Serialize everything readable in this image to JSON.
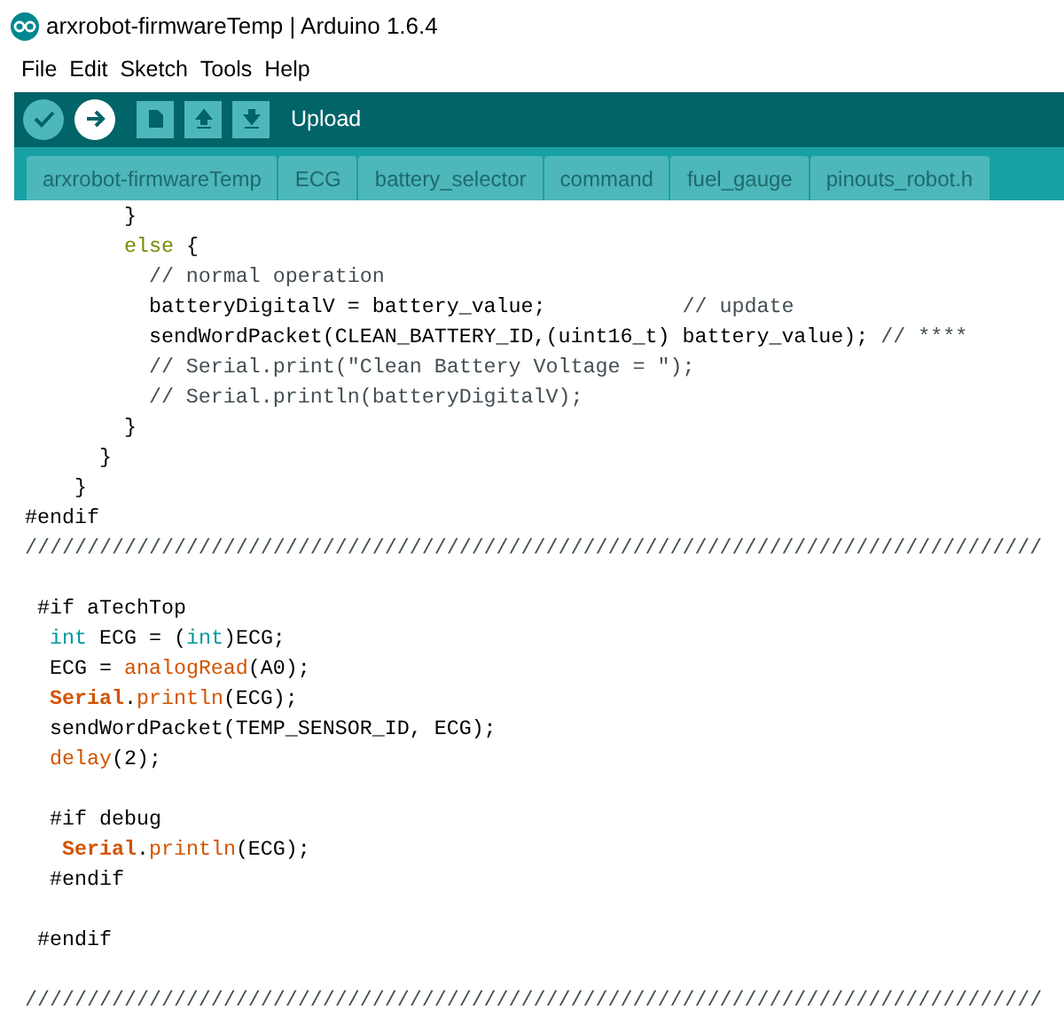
{
  "window": {
    "title": "arxrobot-firmwareTemp | Arduino 1.6.4"
  },
  "menu": [
    "File",
    "Edit",
    "Sketch",
    "Tools",
    "Help"
  ],
  "toolbar": {
    "hover_label": "Upload"
  },
  "tabs": [
    "arxrobot-firmwareTemp",
    "ECG",
    "battery_selector",
    "command",
    "fuel_gauge",
    "pinouts_robot.h"
  ],
  "code_blocks": [
    {
      "lines": [
        {
          "tokens": [
            {
              "kind": "plain",
              "text": "        }"
            }
          ]
        },
        {
          "tokens": [
            {
              "kind": "keyword",
              "text": "        else"
            },
            {
              "kind": "plain",
              "text": " {"
            }
          ]
        },
        {
          "tokens": [
            {
              "kind": "comment",
              "text": "          // normal operation"
            }
          ]
        },
        {
          "tokens": [
            {
              "kind": "plain",
              "text": "          batteryDigitalV = battery_value;           "
            },
            {
              "kind": "comment",
              "text": "// update"
            }
          ]
        },
        {
          "tokens": [
            {
              "kind": "plain",
              "text": "          sendWordPacket(CLEAN_BATTERY_ID,(uint16_t) battery_value); "
            },
            {
              "kind": "comment",
              "text": "// ****"
            }
          ]
        },
        {
          "tokens": [
            {
              "kind": "comment",
              "text": "          // Serial.print(\"Clean Battery Voltage = \");"
            }
          ]
        },
        {
          "tokens": [
            {
              "kind": "comment",
              "text": "          // Serial.println(batteryDigitalV);"
            }
          ]
        },
        {
          "tokens": [
            {
              "kind": "plain",
              "text": "        }"
            }
          ]
        },
        {
          "tokens": [
            {
              "kind": "plain",
              "text": "      }"
            }
          ]
        },
        {
          "tokens": [
            {
              "kind": "plain",
              "text": "    }"
            }
          ]
        },
        {
          "tokens": [
            {
              "kind": "plain",
              "text": "#endif"
            }
          ]
        },
        {
          "tokens": [
            {
              "kind": "comment",
              "text": "//////////////////////////////////////////////////////////////////////////////////"
            }
          ]
        }
      ]
    },
    {
      "lines": [
        {
          "tokens": [
            {
              "kind": "plain",
              "text": " #if aTechTop"
            }
          ]
        },
        {
          "tokens": [
            {
              "kind": "type",
              "text": "  int"
            },
            {
              "kind": "plain",
              "text": " ECG = ("
            },
            {
              "kind": "type",
              "text": "int"
            },
            {
              "kind": "plain",
              "text": ")ECG;"
            }
          ]
        },
        {
          "tokens": [
            {
              "kind": "plain",
              "text": "  ECG = "
            },
            {
              "kind": "function",
              "text": "analogRead"
            },
            {
              "kind": "plain",
              "text": "(A0);"
            }
          ]
        },
        {
          "tokens": [
            {
              "kind": "class",
              "text": "  Serial"
            },
            {
              "kind": "plain",
              "text": "."
            },
            {
              "kind": "function",
              "text": "println"
            },
            {
              "kind": "plain",
              "text": "(ECG);"
            }
          ]
        },
        {
          "tokens": [
            {
              "kind": "plain",
              "text": "  sendWordPacket(TEMP_SENSOR_ID, ECG);"
            }
          ]
        },
        {
          "tokens": [
            {
              "kind": "function",
              "text": "  delay"
            },
            {
              "kind": "plain",
              "text": "(2);"
            }
          ]
        }
      ]
    },
    {
      "lines": [
        {
          "tokens": [
            {
              "kind": "plain",
              "text": "  #if debug"
            }
          ]
        },
        {
          "tokens": [
            {
              "kind": "class",
              "text": "   Serial"
            },
            {
              "kind": "plain",
              "text": "."
            },
            {
              "kind": "function",
              "text": "println"
            },
            {
              "kind": "plain",
              "text": "(ECG);"
            }
          ]
        },
        {
          "tokens": [
            {
              "kind": "plain",
              "text": "  #endif"
            }
          ]
        }
      ]
    },
    {
      "lines": [
        {
          "tokens": [
            {
              "kind": "plain",
              "text": " #endif"
            }
          ]
        }
      ]
    },
    {
      "lines": [
        {
          "tokens": [
            {
              "kind": "comment",
              "text": "//////////////////////////////////////////////////////////////////////////////////"
            }
          ]
        }
      ]
    }
  ]
}
